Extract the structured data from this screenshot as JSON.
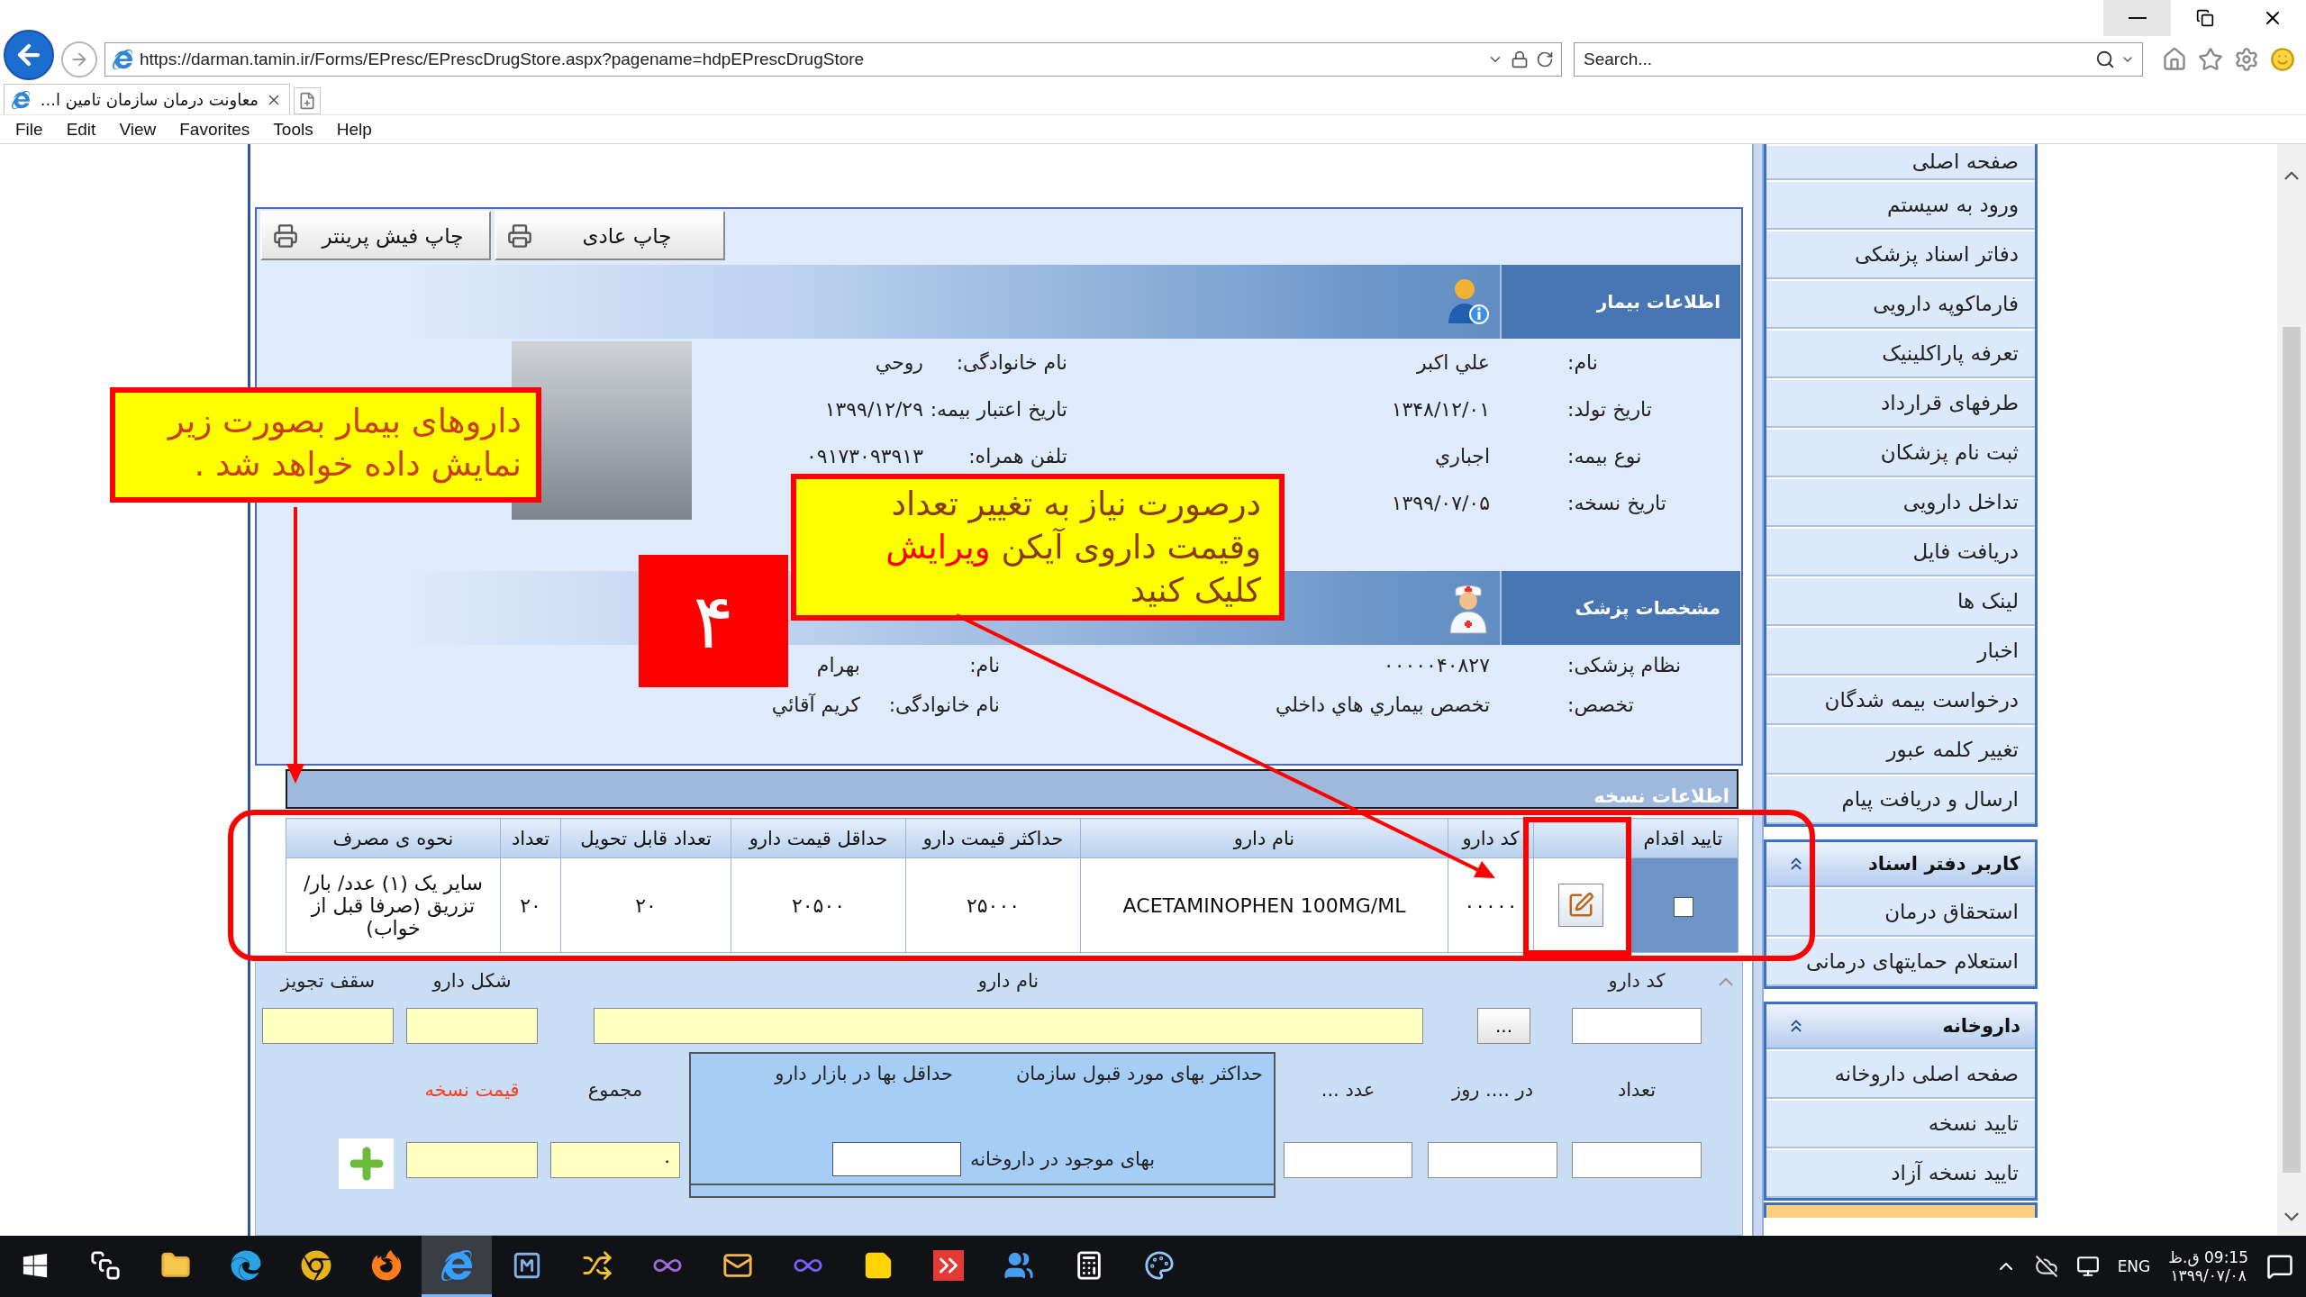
{
  "browser": {
    "url": "https://darman.tamin.ir/Forms/EPresc/EPrescDrugStore.aspx?pagename=hdpEPrescDrugStore",
    "search_placeholder": "Search...",
    "tabs": [
      {
        "title": "معاونت درمان سازمان تامین ا...",
        "selected": true
      }
    ],
    "menu": [
      "Help",
      "Tools",
      "Favorites",
      "View",
      "Edit",
      "File"
    ]
  },
  "print_buttons": [
    "چاپ عادی",
    "چاپ فیش پرینتر"
  ],
  "patient": {
    "title": "اطلاعات بیمار",
    "fields": [
      {
        "label": "نام:",
        "value": "علي اکبر"
      },
      {
        "label": "نام خانوادگی:",
        "value": "روحي"
      },
      {
        "label": "تاریخ تولد:",
        "value": "۱۳۴۸/۱۲/۰۱"
      },
      {
        "label": "تاریخ اعتبار بیمه:",
        "value": "۱۳۹۹/۱۲/۲۹"
      },
      {
        "label": "نوع بیمه:",
        "value": "اجباري"
      },
      {
        "label": "تلفن همراه:",
        "value": "۰۹۱۷۳۰۹۳۹۱۳"
      },
      {
        "label": "تاریخ نسخه:",
        "value": "۱۳۹۹/۰۷/۰۵"
      }
    ]
  },
  "doctor": {
    "title": "مشخصات پزشک",
    "fields": [
      {
        "label": "نظام پزشکی:",
        "value": "۰۰۰۰۰۴۰۸۲۷"
      },
      {
        "label": "نام:",
        "value": "بهرام"
      },
      {
        "label": "تخصص:",
        "value": "تخصص بيماري هاي داخلي"
      },
      {
        "label": "نام خانوادگی:",
        "value": "کريم آقائي"
      }
    ]
  },
  "prescription": {
    "title": "اطلاعات نسخه",
    "columns": [
      "تایید اقدام",
      "",
      "کد دارو",
      "نام دارو",
      "حداکثر قیمت دارو",
      "حداقل قیمت دارو",
      "تعداد قابل تحویل",
      "تعداد",
      "نحوه ی مصرف"
    ],
    "rows": [
      {
        "confirmed": false,
        "cells": [
          "",
          "",
          "۰۰۰۰۰",
          "ACETAMINOPHEN 100MG/ML",
          "۲۵۰۰۰",
          "۲۰۵۰۰",
          "۲۰",
          "۲۰",
          "سایر یک (۱) عدد/ بار/ تزریق (صرفا قبل از خواب)"
        ]
      }
    ]
  },
  "drug_form": {
    "row_1": [
      {
        "kind": "input",
        "label": "کد دارو",
        "readonly": false
      },
      {
        "kind": "button",
        "label": "..."
      },
      {
        "kind": "input",
        "label": "نام دارو",
        "readonly": true
      },
      {
        "kind": "input",
        "label": "شکل دارو",
        "readonly": true
      },
      {
        "kind": "input",
        "label": "سقف تجویز",
        "readonly": true
      }
    ],
    "row_2": [
      {
        "kind": "input",
        "label": "تعداد",
        "readonly": false
      },
      {
        "kind": "input",
        "label": "در .... روز",
        "readonly": false
      },
      {
        "kind": "input",
        "label": "... عدد",
        "readonly": false
      },
      {
        "kind": "price_box",
        "max_label": "حداکثر بهای مورد قبول سازمان",
        "min_label": "حداقل بها در بازار دارو",
        "price_label": "بهای موجود در داروخانه"
      },
      {
        "kind": "input",
        "label": "مجموع",
        "readonly": true,
        "value": "۰"
      },
      {
        "kind": "input",
        "label": "قیمت نسخه",
        "readonly": true,
        "highlight": true
      },
      {
        "kind": "add"
      }
    ]
  },
  "sidebar": {
    "links": [
      "صفحه اصلی",
      "ورود به سیستم",
      "دفاتر اسناد پزشکی",
      "فارماکوپه دارویی",
      "تعرفه پاراکلینیک",
      "طرفهای قرارداد",
      "ثبت نام پزشکان",
      "تداخل دارویی",
      "دریافت فایل",
      "لینک ها",
      "اخبار",
      "درخواست بیمه شدگان",
      "تغییر کلمه عبور",
      "ارسال و دریافت پیام"
    ],
    "sections": [
      {
        "title": "کاربر دفتر اسناد",
        "expanded": true,
        "items": [
          "استحقاق درمان",
          "استعلام حمایتهای درمانی"
        ]
      },
      {
        "title": "داروخانه",
        "expanded": true,
        "items": [
          "صفحه اصلی داروخانه",
          "تایید نسخه",
          "تایید نسخه آزاد"
        ]
      }
    ]
  },
  "annotations": {
    "note_1": "داروهای بیمار بصورت زیر نمایش داده خواهد شد .",
    "step": "۴",
    "note_2": [
      {
        "text": "درصورت نیاز به تغییر تعداد وقیمت داروی آیکن ",
        "highlight": false
      },
      {
        "text": "ویرایش",
        "highlight": true
      },
      {
        "text": " کلیک کنید",
        "highlight": false
      }
    ]
  },
  "taskbar": {
    "apps": [
      {
        "kind": "start",
        "active": false
      },
      {
        "kind": "taskview",
        "active": false
      },
      {
        "kind": "folder",
        "active": false
      },
      {
        "kind": "edge",
        "active": false
      },
      {
        "kind": "chrome",
        "active": false
      },
      {
        "kind": "firefox",
        "active": false
      },
      {
        "kind": "ie",
        "active": true
      },
      {
        "kind": "app_m",
        "active": false
      },
      {
        "kind": "app_x",
        "active": false
      },
      {
        "kind": "vs_purple",
        "active": false
      },
      {
        "kind": "mail",
        "active": false
      },
      {
        "kind": "vs_blue",
        "active": false
      },
      {
        "kind": "note",
        "active": false
      },
      {
        "kind": "remote",
        "active": false
      },
      {
        "kind": "people",
        "active": false
      },
      {
        "kind": "calculator",
        "active": false
      },
      {
        "kind": "paint",
        "active": false
      }
    ],
    "language": "ENG",
    "time": "09:15 ق.ظ",
    "date": "۱۳۹۹/۰۷/۰۸"
  }
}
